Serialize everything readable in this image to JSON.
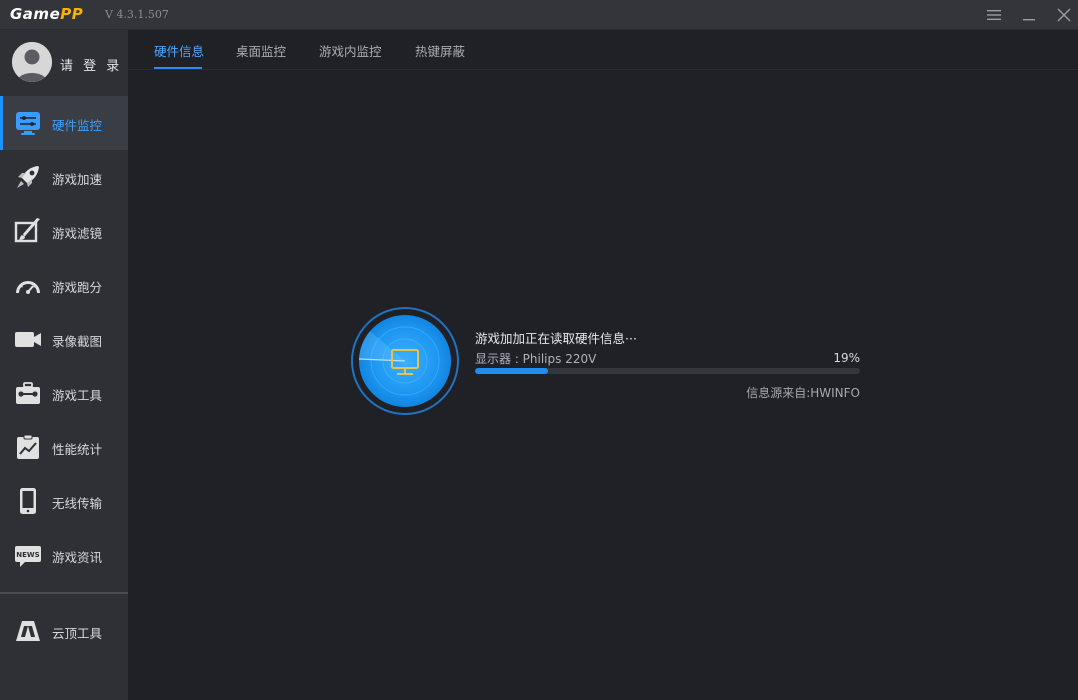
{
  "app": {
    "logo_game": "Game",
    "logo_pp": "PP",
    "version": "V 4.3.1.507"
  },
  "sidebar": {
    "login_label": "请 登 录",
    "items": [
      {
        "label": "硬件监控",
        "icon": "hardware-monitor-icon"
      },
      {
        "label": "游戏加速",
        "icon": "rocket-icon"
      },
      {
        "label": "游戏滤镜",
        "icon": "filter-brush-icon"
      },
      {
        "label": "游戏跑分",
        "icon": "speedometer-icon"
      },
      {
        "label": "录像截图",
        "icon": "video-camera-icon"
      },
      {
        "label": "游戏工具",
        "icon": "toolbox-icon"
      },
      {
        "label": "性能统计",
        "icon": "chart-clipboard-icon"
      },
      {
        "label": "无线传输",
        "icon": "phone-icon"
      },
      {
        "label": "游戏资讯",
        "icon": "news-icon"
      },
      {
        "label": "云顶工具",
        "icon": "cloud-top-icon"
      }
    ],
    "active_index": 0
  },
  "tabs": [
    {
      "label": "硬件信息"
    },
    {
      "label": "桌面监控"
    },
    {
      "label": "游戏内监控"
    },
    {
      "label": "热键屏蔽"
    }
  ],
  "loader": {
    "status_text": "游戏加加正在读取硬件信息···",
    "device_text": "显示器 : Philips 220V",
    "percent_text": "19%",
    "progress": 0.19,
    "source_text": "信息源来自:HWINFO"
  },
  "colors": {
    "accent": "#1e90ff",
    "sidebar_bg": "#2e3036",
    "main_bg": "#202027",
    "logo_pp": "#f5b400"
  }
}
